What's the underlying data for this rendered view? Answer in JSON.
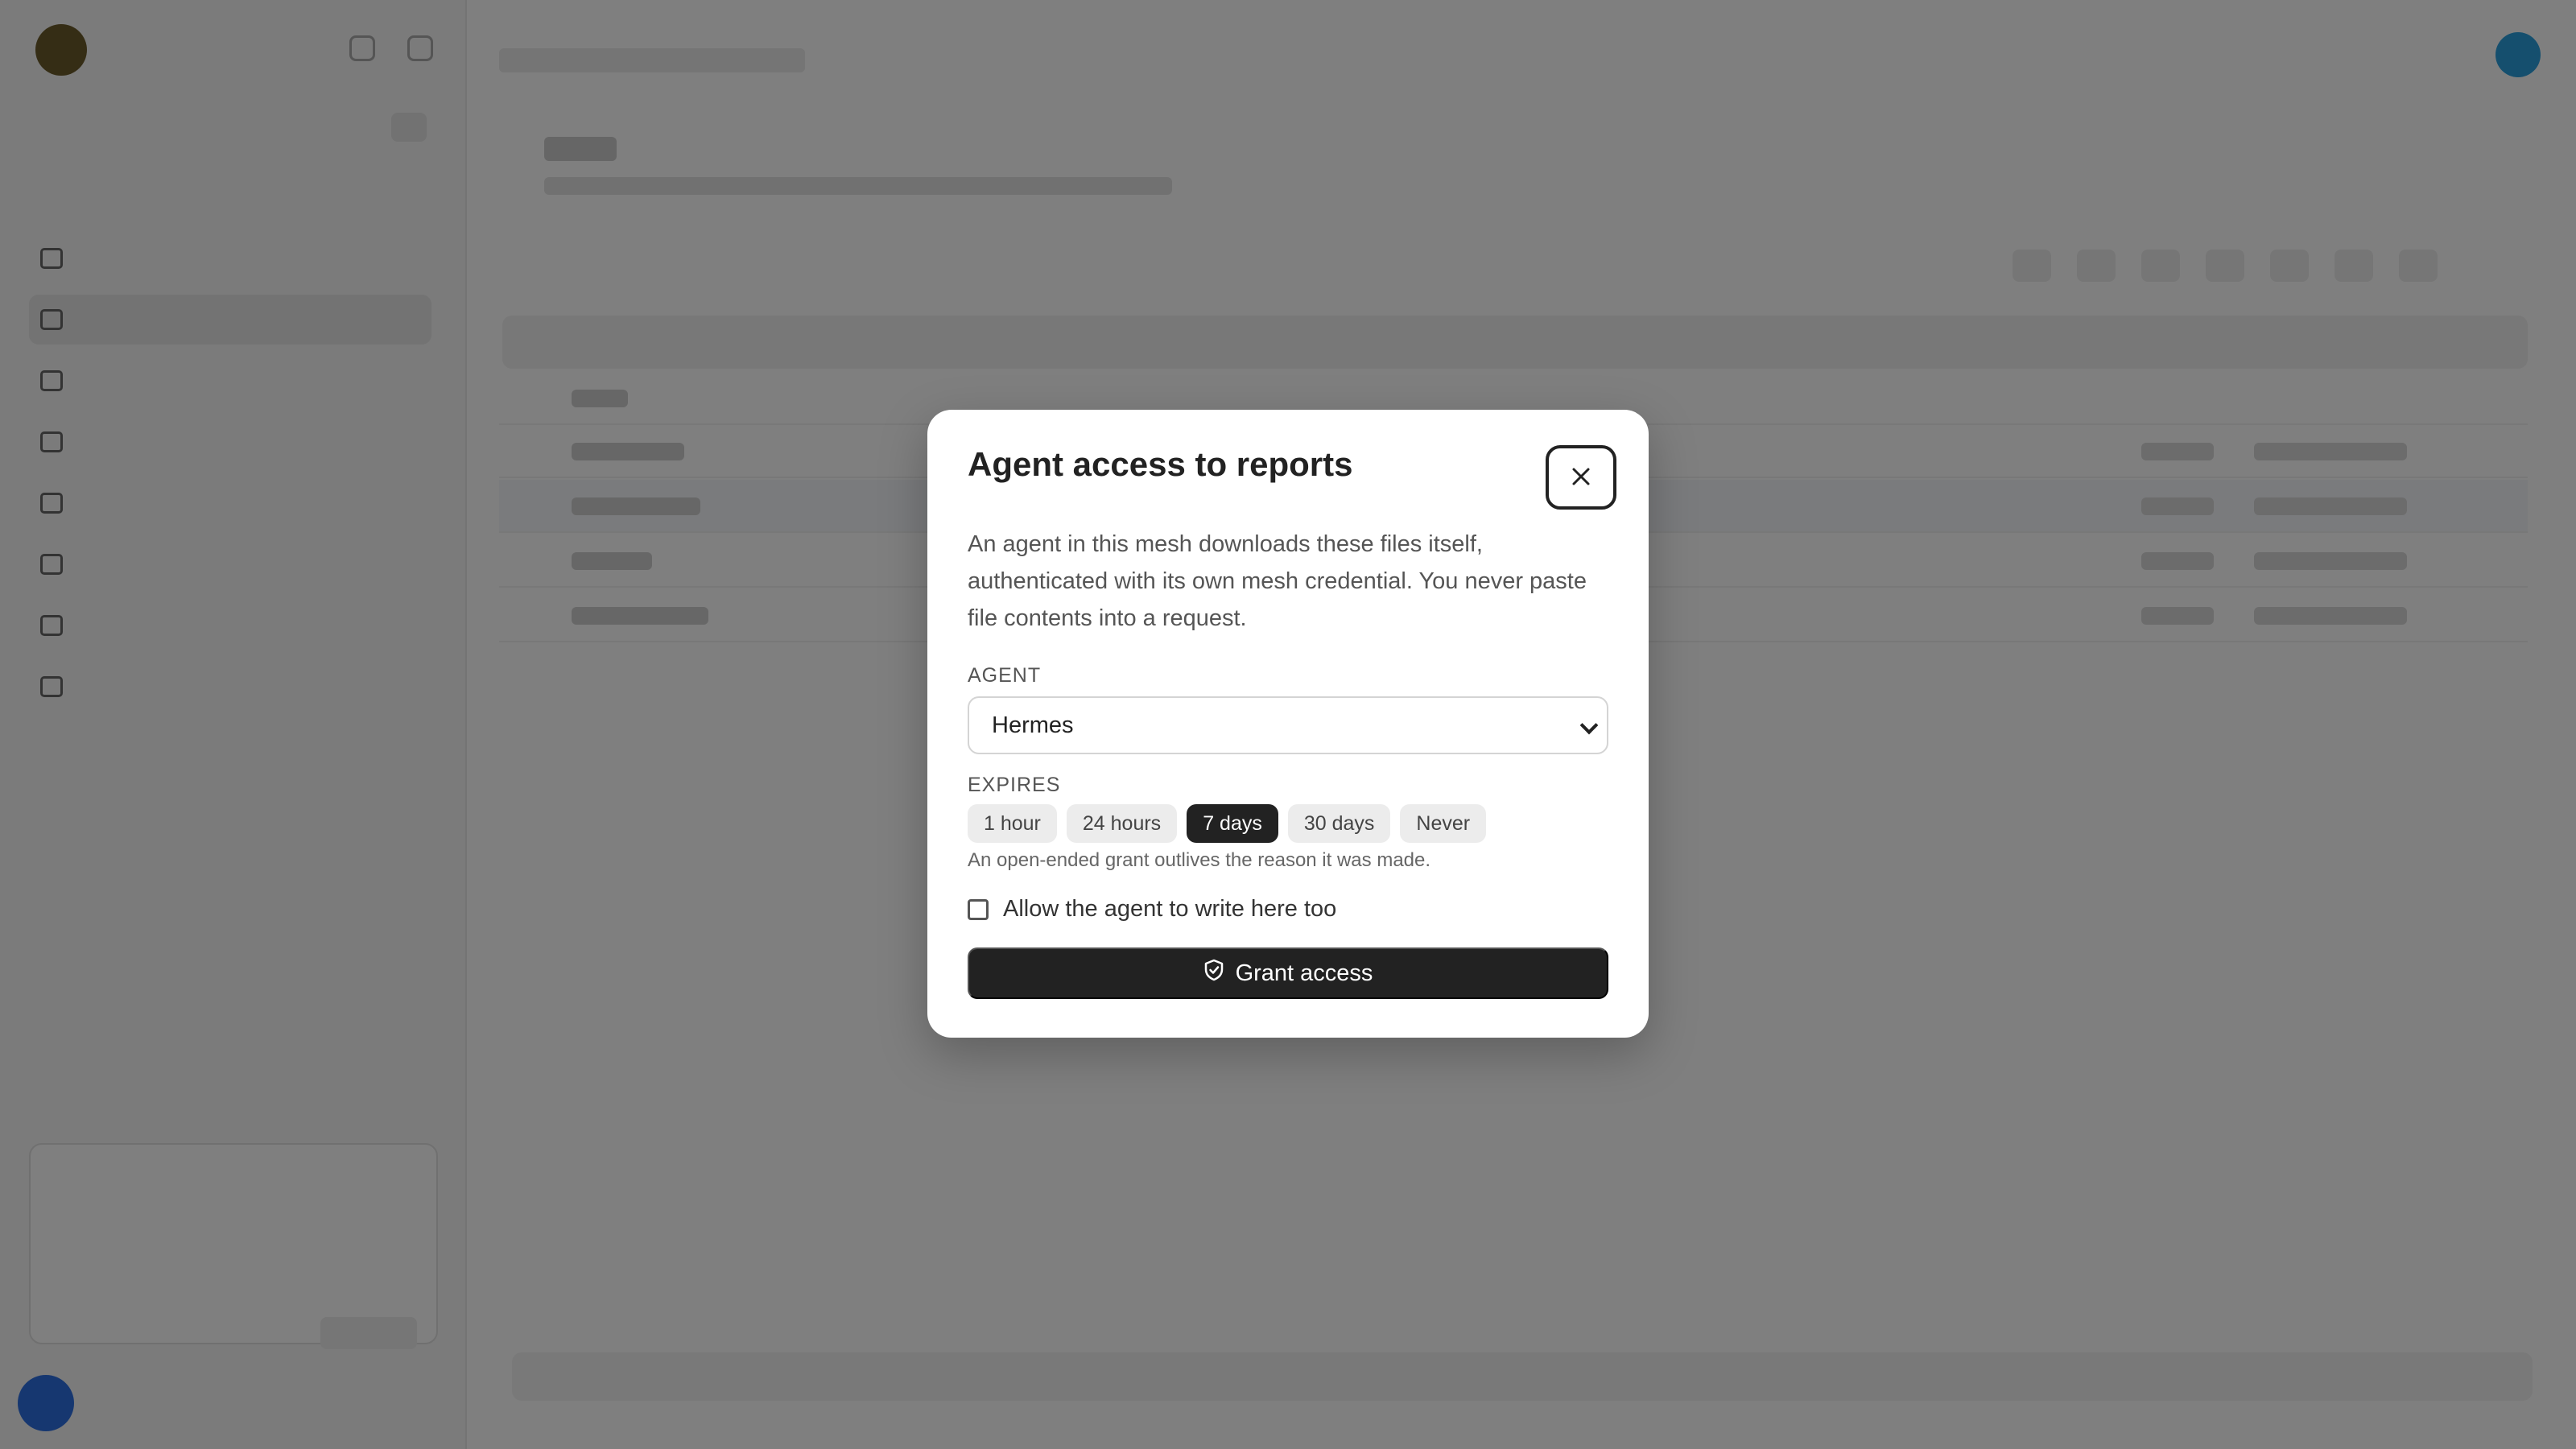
{
  "modal": {
    "title": "Agent access to reports",
    "description": "An agent in this mesh downloads these files itself, authenticated with its own mesh credential. You never paste file contents into a request.",
    "agent_label": "AGENT",
    "agent_value": "Hermes",
    "expires_label": "EXPIRES",
    "expiry_options": [
      "1 hour",
      "24 hours",
      "7 days",
      "30 days",
      "Never"
    ],
    "selected_expiry": "7 days",
    "hint": "An open-ended grant outlives the reason it was made.",
    "write_checkbox_label": "Allow the agent to write here too",
    "write_checked": false,
    "grant_button": "Grant access"
  },
  "colors": {
    "overlay": "#808080",
    "primary_button": "#222222",
    "status_green": "#1fa84f",
    "avatar_blue": "#2d6fe0"
  }
}
